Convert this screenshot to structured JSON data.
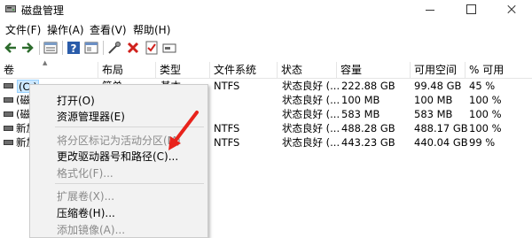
{
  "window": {
    "title": "磁盘管理",
    "controls": {
      "minimize": "minimize",
      "maximize": "maximize",
      "close": "close"
    }
  },
  "menu": [
    "文件(F)",
    "操作(A)",
    "查看(V)",
    "帮助(H)"
  ],
  "toolbar": {
    "icons": [
      "back-icon",
      "forward-icon",
      "volume-list-icon",
      "help-icon",
      "properties-icon",
      "connect-icon",
      "delete-icon",
      "check-icon",
      "disk-icon"
    ]
  },
  "table": {
    "columns": [
      "卷",
      "布局",
      "类型",
      "文件系统",
      "状态",
      "容量",
      "可用空间",
      "% 可用"
    ],
    "rows": [
      {
        "volume": "(C:)",
        "layout": "简单",
        "type": "基本",
        "fs": "NTFS",
        "status": "状态良好 (...",
        "capacity": "222.88 GB",
        "free": "99.48 GB",
        "pct": "45 %"
      },
      {
        "volume": "(磁盘",
        "layout": "",
        "type": "",
        "fs": "",
        "status": "状态良好 (...",
        "capacity": "100 MB",
        "free": "100 MB",
        "pct": "100 %"
      },
      {
        "volume": "(磁盘",
        "layout": "",
        "type": "",
        "fs": "",
        "status": "状态良好 (...",
        "capacity": "583 MB",
        "free": "583 MB",
        "pct": "100 %"
      },
      {
        "volume": "新加",
        "layout": "",
        "type": "",
        "fs": "NTFS",
        "status": "状态良好 (...",
        "capacity": "488.28 GB",
        "free": "488.17 GB",
        "pct": "100 %"
      },
      {
        "volume": "新加",
        "layout": "",
        "type": "",
        "fs": "NTFS",
        "status": "状态良好 (...",
        "capacity": "443.23 GB",
        "free": "440.04 GB",
        "pct": "99 %"
      }
    ]
  },
  "context_menu": {
    "open": "打开(O)",
    "explorer": "资源管理器(E)",
    "mark_active": "将分区标记为活动分区(M)",
    "change_letter": "更改驱动器号和路径(C)...",
    "format": "格式化(F)...",
    "extend": "扩展卷(X)...",
    "shrink": "压缩卷(H)...",
    "add_mirror": "添加镜像(A)..."
  },
  "colors": {
    "selection": "#cce8ff",
    "annotation_arrow": "#e8231c",
    "disabled_text": "#8a8a8a"
  }
}
